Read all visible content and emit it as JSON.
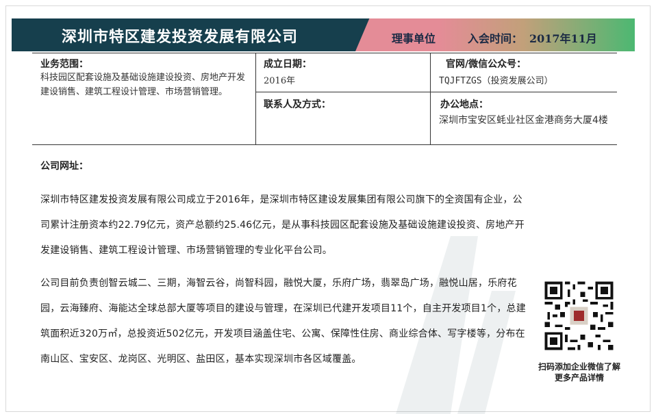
{
  "header": {
    "company_name": "深圳市特区建发投资发展有限公司",
    "member_type": "理事单位",
    "join_label": "入会时间：",
    "join_value": "2017年11月"
  },
  "info": {
    "scope_label": "业务范围：",
    "scope_value": "科技园区配套设施及基础设施建设投资、房地产开发建设销售、建筑工程设计管理、市场营销管理。",
    "founded_label": "成立日期：",
    "founded_value": "2016年",
    "website_label": "官网/微信公众号：",
    "website_value": "TQJFTZGS（投资发展公司）",
    "contact_label": "联系人及方式：",
    "contact_value": "",
    "office_label": "办公地点：",
    "office_value": "深圳市宝安区蚝业社区金港商务大厦4楼"
  },
  "company_url_label": "公司网址：",
  "description": {
    "para1": "深圳市特区建发投资发展有限公司成立于2016年，是深圳市特区建设发展集团有限公司旗下的全资国有企业，公司累计注册资本约22.79亿元，资产总额约25.46亿元，是从事科技园区配套设施及基础设施建设投资、房地产开发建设销售、建筑工程设计管理、市场营销管理的专业化平台公司。",
    "para2": "公司目前负责创智云城二、三期，海智云谷，尚智科园，融悦大厦，乐府广场，翡翠岛广场，融悦山居，乐府花园，云海臻府、海能达全球总部大厦等项目的建设与管理，在深圳已代建开发项目11个，自主开发项目1个，总建筑面积近320万㎡，总投资近502亿元，开发项目涵盖住宅、公寓、保障性住房、商业综合体、写字楼等，分布在南山区、宝安区、龙岗区、光明区、盐田区，基本实现深圳市各区域覆盖。"
  },
  "qr": {
    "caption": "扫码添加企业微信了解更多产品详情",
    "icon": "qr-code-icon"
  },
  "colors": {
    "title_banner": "#163f4d",
    "member_banner_start": "#e48c97",
    "member_banner_end": "#4cb872"
  }
}
